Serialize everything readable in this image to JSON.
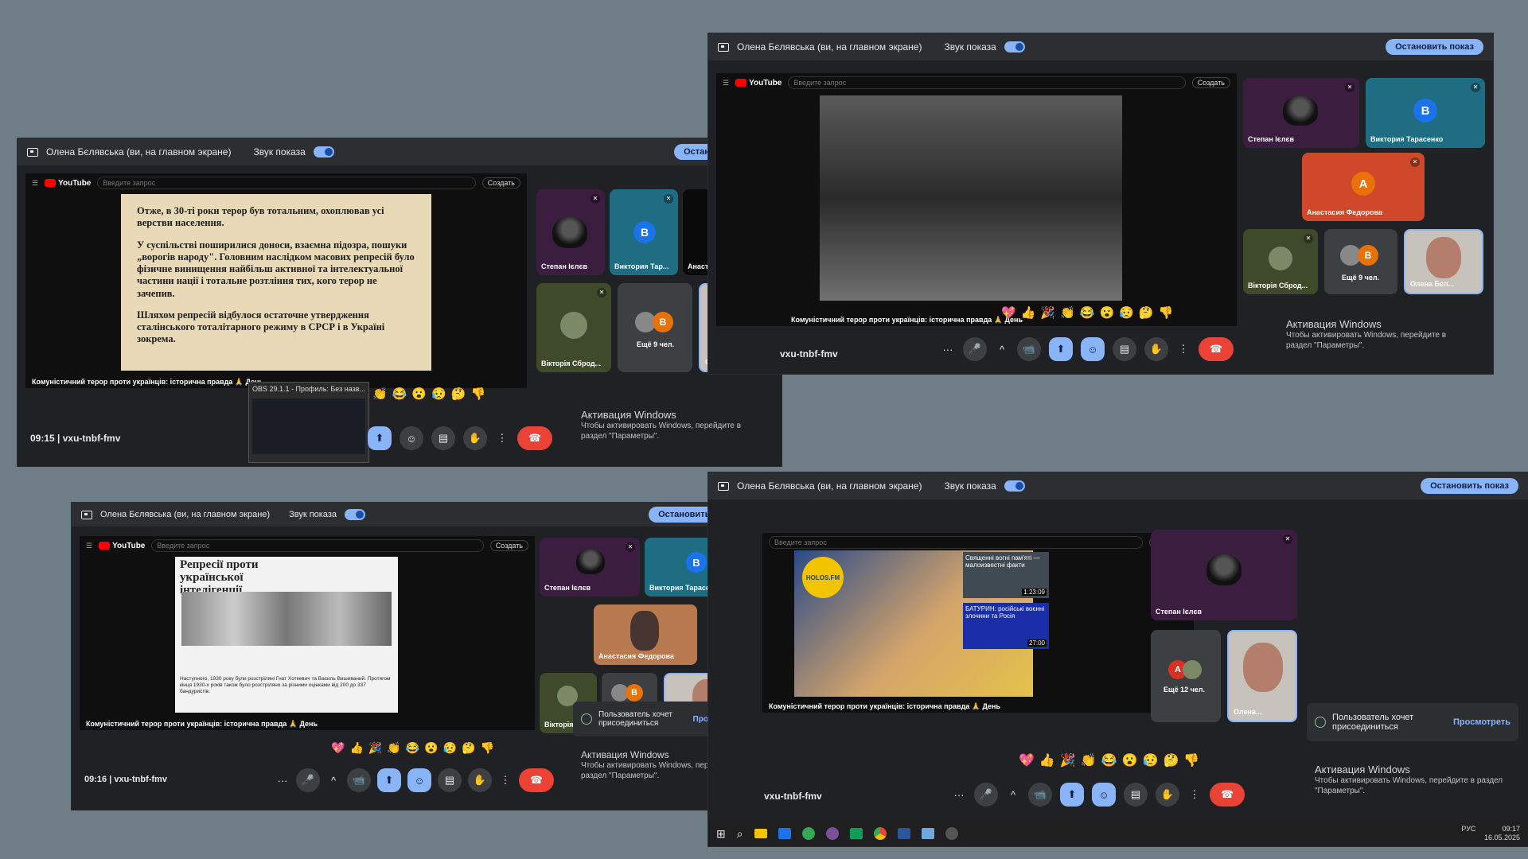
{
  "common": {
    "presenter_label": "Олена Бєлявська (ви, на главном экране)",
    "sound_label": "Звук показа",
    "stop_label": "Остановить показ",
    "yt_brand": "YouTube",
    "yt_search_placeholder": "Введите запрос",
    "yt_create": "Создать",
    "video_caption": "Комуністичний терор проти українців: історична правда 🙏 День",
    "meet_code": "vxu-tnbf-fmv",
    "activation_title": "Активация Windows",
    "activation_sub": "Чтобы активировать Windows, перейдите в раздел \"Параметры\"."
  },
  "participants": {
    "stepan": "Степан Ієлєв",
    "viktoria_t": "Виктория Тарасенко",
    "viktoria_t_short": "Виктория Тар...",
    "anastasia": "Анастасія Федорова",
    "anastasia_ru": "Анастасия Федорова",
    "viktoria_s": "Вікторія Сброд...",
    "olena": "Олена Бєл...",
    "olena_short": "Олена...",
    "more9": "Ещё 9 чел.",
    "more12": "Ещё 12 чел."
  },
  "avatar_letters": {
    "b": "В",
    "a": "А",
    "b2": "B"
  },
  "slide1_paragraphs": [
    "Отже, в 30-ті роки терор був тотальним, охоплював усі верстви населення.",
    "У суспільстві поширилися доноси, взаємна підозра, пошуки „ворогів народу\". Головним наслідком масових репресій було фізичне винищення найбільш активної та інтелектуальної частини нації і тотальне розтління тих, кого терор не зачепив.",
    "Шляхом репресій відбулося остаточне утвердження сталінського тоталітарного режиму в СРСР і в Україні зокрема."
  ],
  "slide3_title": "Репресії проти української інтелігенції",
  "slide3_tail": "Наступного, 1930 року були розстріляні Гнат Хоткевич та Василь Вишиваний. Протягом кінця 1930-х років також було розстріляно за різними оцінками від 200 до 337 бандуристів.",
  "obs_label": "OBS 29.1.1 - Профиль: Без назв...",
  "panel_times": {
    "p1": "09:15",
    "p3": "09:16"
  },
  "join_toast": {
    "text": "Пользователь хочет присоединиться",
    "view": "Просмотреть"
  },
  "holos_logo": "HOLOS.FM",
  "side_videos": [
    {
      "title": "Священні вогні пам'яті — малоизвестні факти",
      "time": "1:23:09"
    },
    {
      "title": "БАТУРИН: російські воєнні злочини та Росія",
      "time": "27:00"
    }
  ],
  "reactions": [
    "💖",
    "👍",
    "🎉",
    "👏",
    "😂",
    "😮",
    "😥",
    "🤔",
    "👎"
  ],
  "reactions_short": [
    "👏",
    "😂",
    "😮",
    "😥",
    "🤔",
    "👎"
  ],
  "tray": {
    "lang": "РУС",
    "time": "09:17",
    "date": "16.05.2025"
  },
  "icons": {
    "mic": "🎤",
    "cam": "📹",
    "present": "⬆",
    "emoji": "☺",
    "captions": "▤",
    "hand": "✋",
    "more": "⋮",
    "end": "☎",
    "chevron": "^",
    "dots": "···",
    "info": "ⓘ",
    "people": "👥",
    "chat": "💬",
    "apps": "⋮⋮",
    "lock": "🔒",
    "timer": "⏱",
    "win": "⊞",
    "search": "⌕"
  }
}
